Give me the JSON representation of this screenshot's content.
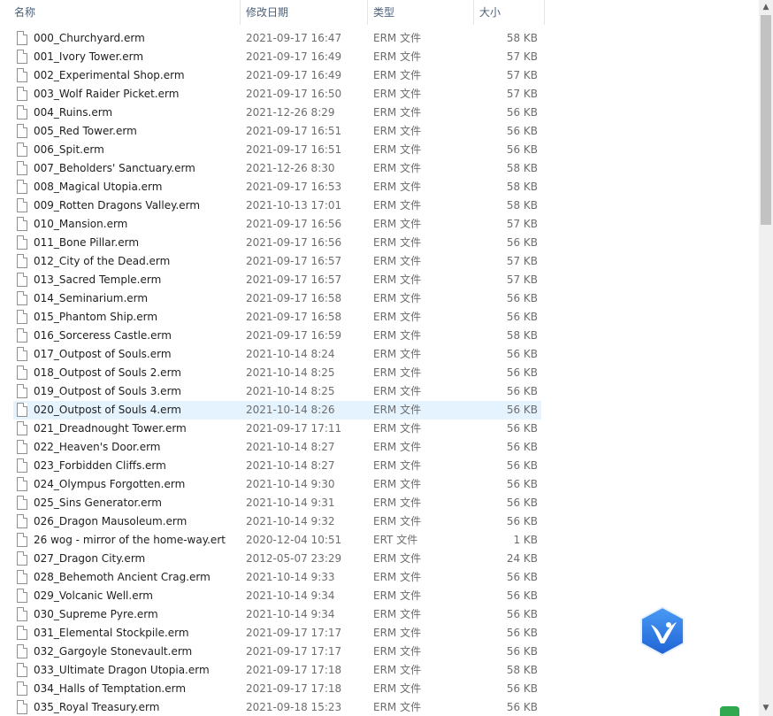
{
  "columns": {
    "name": "名称",
    "date": "修改日期",
    "type": "类型",
    "size": "大小"
  },
  "sort_indicator": "^",
  "selected_row_index": 20,
  "files": [
    {
      "name": "000_Churchyard.erm",
      "date": "2021-09-17 16:47",
      "type": "ERM 文件",
      "size": "58 KB"
    },
    {
      "name": "001_Ivory Tower.erm",
      "date": "2021-09-17 16:49",
      "type": "ERM 文件",
      "size": "57 KB"
    },
    {
      "name": "002_Experimental Shop.erm",
      "date": "2021-09-17 16:49",
      "type": "ERM 文件",
      "size": "57 KB"
    },
    {
      "name": "003_Wolf Raider Picket.erm",
      "date": "2021-09-17 16:50",
      "type": "ERM 文件",
      "size": "57 KB"
    },
    {
      "name": "004_Ruins.erm",
      "date": "2021-12-26 8:29",
      "type": "ERM 文件",
      "size": "56 KB"
    },
    {
      "name": "005_Red Tower.erm",
      "date": "2021-09-17 16:51",
      "type": "ERM 文件",
      "size": "56 KB"
    },
    {
      "name": "006_Spit.erm",
      "date": "2021-09-17 16:51",
      "type": "ERM 文件",
      "size": "56 KB"
    },
    {
      "name": "007_Beholders' Sanctuary.erm",
      "date": "2021-12-26 8:30",
      "type": "ERM 文件",
      "size": "58 KB"
    },
    {
      "name": "008_Magical Utopia.erm",
      "date": "2021-09-17 16:53",
      "type": "ERM 文件",
      "size": "58 KB"
    },
    {
      "name": "009_Rotten Dragons Valley.erm",
      "date": "2021-10-13 17:01",
      "type": "ERM 文件",
      "size": "58 KB"
    },
    {
      "name": "010_Mansion.erm",
      "date": "2021-09-17 16:56",
      "type": "ERM 文件",
      "size": "57 KB"
    },
    {
      "name": "011_Bone Pillar.erm",
      "date": "2021-09-17 16:56",
      "type": "ERM 文件",
      "size": "56 KB"
    },
    {
      "name": "012_City of the Dead.erm",
      "date": "2021-09-17 16:57",
      "type": "ERM 文件",
      "size": "57 KB"
    },
    {
      "name": "013_Sacred Temple.erm",
      "date": "2021-09-17 16:57",
      "type": "ERM 文件",
      "size": "57 KB"
    },
    {
      "name": "014_Seminarium.erm",
      "date": "2021-09-17 16:58",
      "type": "ERM 文件",
      "size": "56 KB"
    },
    {
      "name": "015_Phantom Ship.erm",
      "date": "2021-09-17 16:58",
      "type": "ERM 文件",
      "size": "56 KB"
    },
    {
      "name": "016_Sorceress Castle.erm",
      "date": "2021-09-17 16:59",
      "type": "ERM 文件",
      "size": "58 KB"
    },
    {
      "name": "017_Outpost of Souls.erm",
      "date": "2021-10-14 8:24",
      "type": "ERM 文件",
      "size": "56 KB"
    },
    {
      "name": "018_Outpost of Souls 2.erm",
      "date": "2021-10-14 8:25",
      "type": "ERM 文件",
      "size": "56 KB"
    },
    {
      "name": "019_Outpost of Souls 3.erm",
      "date": "2021-10-14 8:25",
      "type": "ERM 文件",
      "size": "56 KB"
    },
    {
      "name": "020_Outpost of Souls 4.erm",
      "date": "2021-10-14 8:26",
      "type": "ERM 文件",
      "size": "56 KB"
    },
    {
      "name": "021_Dreadnought Tower.erm",
      "date": "2021-09-17 17:11",
      "type": "ERM 文件",
      "size": "56 KB"
    },
    {
      "name": "022_Heaven's Door.erm",
      "date": "2021-10-14 8:27",
      "type": "ERM 文件",
      "size": "56 KB"
    },
    {
      "name": "023_Forbidden Cliffs.erm",
      "date": "2021-10-14 8:27",
      "type": "ERM 文件",
      "size": "56 KB"
    },
    {
      "name": "024_Olympus Forgotten.erm",
      "date": "2021-10-14 9:30",
      "type": "ERM 文件",
      "size": "56 KB"
    },
    {
      "name": "025_Sins Generator.erm",
      "date": "2021-10-14 9:31",
      "type": "ERM 文件",
      "size": "56 KB"
    },
    {
      "name": "026_Dragon Mausoleum.erm",
      "date": "2021-10-14 9:32",
      "type": "ERM 文件",
      "size": "56 KB"
    },
    {
      "name": "26 wog - mirror of the home-way.ert",
      "date": "2020-12-04 10:51",
      "type": "ERT 文件",
      "size": "1 KB"
    },
    {
      "name": "027_Dragon City.erm",
      "date": "2012-05-07 23:29",
      "type": "ERM 文件",
      "size": "24 KB"
    },
    {
      "name": "028_Behemoth Ancient Crag.erm",
      "date": "2021-10-14 9:33",
      "type": "ERM 文件",
      "size": "56 KB"
    },
    {
      "name": "029_Volcanic Well.erm",
      "date": "2021-10-14 9:34",
      "type": "ERM 文件",
      "size": "56 KB"
    },
    {
      "name": "030_Supreme Pyre.erm",
      "date": "2021-10-14 9:34",
      "type": "ERM 文件",
      "size": "56 KB"
    },
    {
      "name": "031_Elemental Stockpile.erm",
      "date": "2021-09-17 17:17",
      "type": "ERM 文件",
      "size": "56 KB"
    },
    {
      "name": "032_Gargoyle Stonevault.erm",
      "date": "2021-09-17 17:17",
      "type": "ERM 文件",
      "size": "56 KB"
    },
    {
      "name": "033_Ultimate Dragon Utopia.erm",
      "date": "2021-09-17 17:18",
      "type": "ERM 文件",
      "size": "58 KB"
    },
    {
      "name": "034_Halls of Temptation.erm",
      "date": "2021-09-17 17:18",
      "type": "ERM 文件",
      "size": "56 KB"
    },
    {
      "name": "035_Royal Treasury.erm",
      "date": "2021-09-18 15:23",
      "type": "ERM 文件",
      "size": "56 KB"
    }
  ],
  "icons": {
    "file": "file-icon",
    "float_app": "bird-hexagon-icon",
    "scroll_up": "chevron-up-icon",
    "scroll_down": "chevron-down-icon"
  },
  "colors": {
    "selection": "#e5f3ff",
    "header_text": "#4c607a",
    "float_app_blue": "#2f7fe8"
  }
}
